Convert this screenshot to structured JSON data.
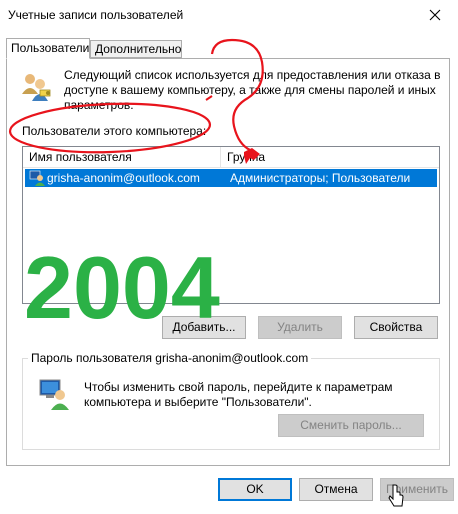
{
  "window": {
    "title": "Учетные записи пользователей"
  },
  "tabs": [
    {
      "label": "Пользователи",
      "active": true
    },
    {
      "label": "Дополнительно",
      "active": false
    }
  ],
  "description": "Следующий список используется для предоставления или отказа в доступе к вашему компьютеру, а также для смены паролей и иных параметров.",
  "users_label": "Пользователи этого компьютера:",
  "listview": {
    "columns": [
      "Имя пользователя",
      "Группа"
    ],
    "rows": [
      {
        "username": "grisha-anonim@outlook.com",
        "group": "Администраторы; Пользователи",
        "selected": true
      }
    ]
  },
  "buttons": {
    "add": "Добавить...",
    "remove": "Удалить",
    "properties": "Свойства",
    "change_password": "Сменить пароль...",
    "ok": "OK",
    "cancel": "Отмена",
    "apply": "Применить"
  },
  "password_group": {
    "legend": "Пароль пользователя grisha-anonim@outlook.com",
    "text": "Чтобы изменить свой пароль, перейдите к параметрам компьютера и выберите \"Пользователи\"."
  },
  "overlay_text": "2004",
  "colors": {
    "selection": "#0078d7",
    "annotation_red": "#e8141c",
    "annotation_green": "#2bb146"
  }
}
